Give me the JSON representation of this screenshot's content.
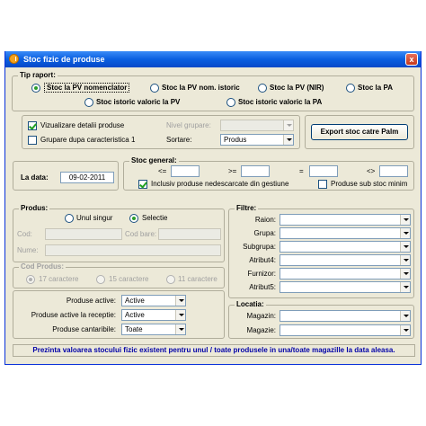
{
  "window": {
    "title": "Stoc fizic de produse",
    "close_label": "x"
  },
  "tip_raport": {
    "label": "Tip raport:",
    "options": [
      {
        "label": "Stoc la PV nomenclator",
        "selected": true
      },
      {
        "label": "Stoc la PV nom. istoric",
        "selected": false
      },
      {
        "label": "Stoc la PV (NIR)",
        "selected": false
      },
      {
        "label": "Stoc la PA",
        "selected": false
      },
      {
        "label": "Stoc istoric valoric la PV",
        "selected": false
      },
      {
        "label": "Stoc istoric valoric la PA",
        "selected": false
      }
    ]
  },
  "options_panel": {
    "vizualizare_label": "Vizualizare detalii produse",
    "vizualizare_checked": true,
    "grupare_label": "Grupare dupa caracteristica 1",
    "grupare_checked": false,
    "nivel_grupare_label": "Nivel grupare:",
    "nivel_grupare_value": "",
    "sortare_label": "Sortare:",
    "sortare_value": "Produs",
    "export_button": "Export stoc catre Palm"
  },
  "date_panel": {
    "label": "La data:",
    "value": "09-02-2011"
  },
  "stoc_general": {
    "label": "Stoc general:",
    "op_lt": "<=",
    "op_ge": ">=",
    "op_eq": "=",
    "op_ne": "<>",
    "v_lt": "",
    "v_ge": "",
    "v_eq": "",
    "v_ne": "",
    "inclusiv_label": "Inclusiv produse nedescarcate din gestiune",
    "inclusiv_checked": true,
    "sub_minim_label": "Produse sub stoc minim",
    "sub_minim_checked": false
  },
  "produs": {
    "label": "Produs:",
    "unul_singur": "Unul singur",
    "selectie": "Selectie",
    "cod_label": "Cod:",
    "cod_bare_label": "Cod bare:",
    "nume_label": "Nume:",
    "cod_value": "",
    "cod_bare_value": "",
    "nume_value": ""
  },
  "cod_produs": {
    "label": "Cod Produs:",
    "options": [
      "17 caractere",
      "15 caractere",
      "11 caractere"
    ]
  },
  "produse_filters": [
    {
      "label": "Produse active:",
      "value": "Active"
    },
    {
      "label": "Produse active la receptie:",
      "value": "Active"
    },
    {
      "label": "Produse cantaribile:",
      "value": "Toate"
    }
  ],
  "filtre": {
    "label": "Filtre:",
    "items": [
      {
        "label": "Raion:",
        "value": ""
      },
      {
        "label": "Grupa:",
        "value": ""
      },
      {
        "label": "Subgrupa:",
        "value": ""
      },
      {
        "label": "Atribut4:",
        "value": ""
      },
      {
        "label": "Furnizor:",
        "value": ""
      },
      {
        "label": "Atribut5:",
        "value": ""
      }
    ]
  },
  "locatia": {
    "label": "Locatia:",
    "items": [
      {
        "label": "Magazin:",
        "value": ""
      },
      {
        "label": "Magazie:",
        "value": ""
      }
    ]
  },
  "status_text": "Prezinta valoarea stocului fizic existent pentru unul / toate produsele in una/toate magazille la data  aleasa."
}
